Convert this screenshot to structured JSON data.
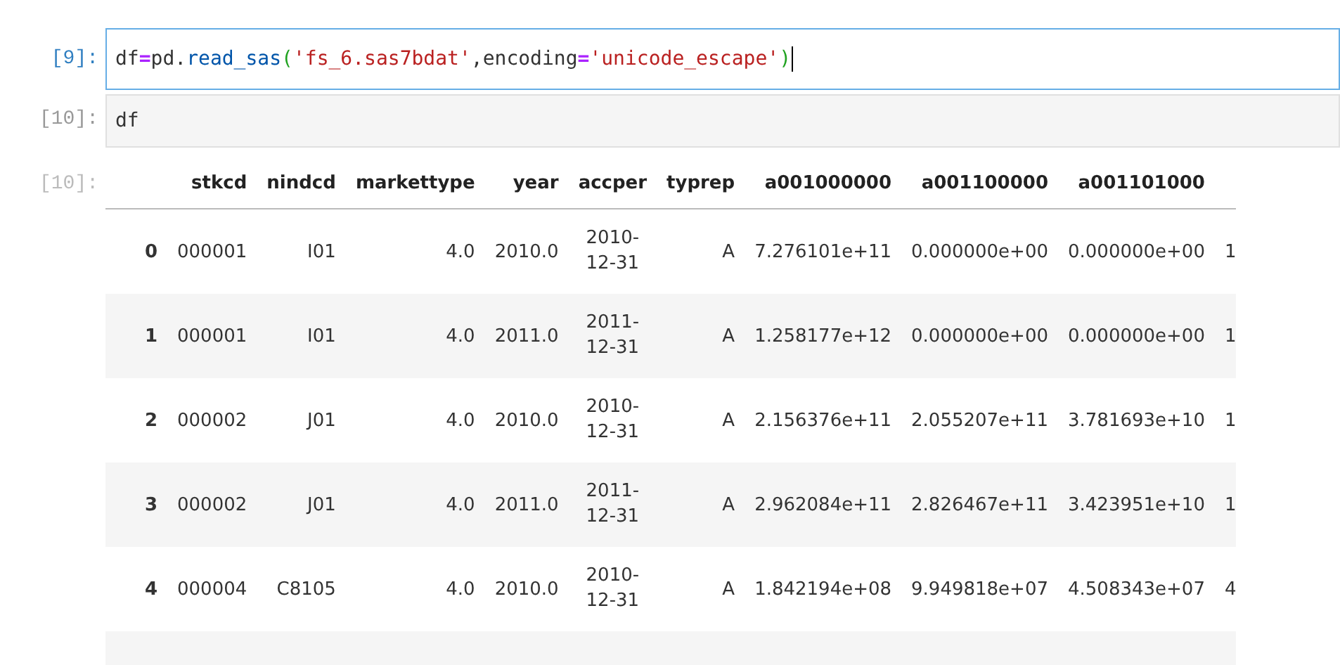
{
  "cells": [
    {
      "kind": "code",
      "prompt": "[9]:",
      "selected": true,
      "tokens": [
        {
          "kind": "name",
          "text": "df"
        },
        {
          "kind": "operator",
          "text": "="
        },
        {
          "kind": "name",
          "text": "pd."
        },
        {
          "kind": "call",
          "text": "read_sas"
        },
        {
          "kind": "paren",
          "text": "("
        },
        {
          "kind": "string",
          "text": "'fs_6.sas7bdat'"
        },
        {
          "kind": "name",
          "text": ",encoding"
        },
        {
          "kind": "operator",
          "text": "="
        },
        {
          "kind": "string",
          "text": "'unicode_escape'"
        },
        {
          "kind": "paren",
          "text": ")"
        }
      ]
    },
    {
      "kind": "code",
      "prompt": "[10]:",
      "selected": false,
      "tokens": [
        {
          "kind": "name",
          "text": "df"
        }
      ]
    },
    {
      "kind": "output",
      "prompt": "[10]:",
      "table": {
        "columns": [
          "",
          "stkcd",
          "nindcd",
          "markettype",
          "year",
          "accper",
          "typrep",
          "a001000000",
          "a001100000",
          "a001101000",
          ""
        ],
        "rows": [
          [
            "0",
            "000001",
            "I01",
            "4.0",
            "2010.0",
            "2010-12-31",
            "A",
            "7.276101e+11",
            "0.000000e+00",
            "0.000000e+00",
            "1"
          ],
          [
            "1",
            "000001",
            "I01",
            "4.0",
            "2011.0",
            "2011-12-31",
            "A",
            "1.258177e+12",
            "0.000000e+00",
            "0.000000e+00",
            "1"
          ],
          [
            "2",
            "000002",
            "J01",
            "4.0",
            "2010.0",
            "2010-12-31",
            "A",
            "2.156376e+11",
            "2.055207e+11",
            "3.781693e+10",
            "1"
          ],
          [
            "3",
            "000002",
            "J01",
            "4.0",
            "2011.0",
            "2011-12-31",
            "A",
            "2.962084e+11",
            "2.826467e+11",
            "3.423951e+10",
            "1"
          ],
          [
            "4",
            "000004",
            "C8105",
            "4.0",
            "2010.0",
            "2010-12-31",
            "A",
            "1.842194e+08",
            "9.949818e+07",
            "4.508343e+07",
            "4"
          ]
        ]
      }
    }
  ]
}
